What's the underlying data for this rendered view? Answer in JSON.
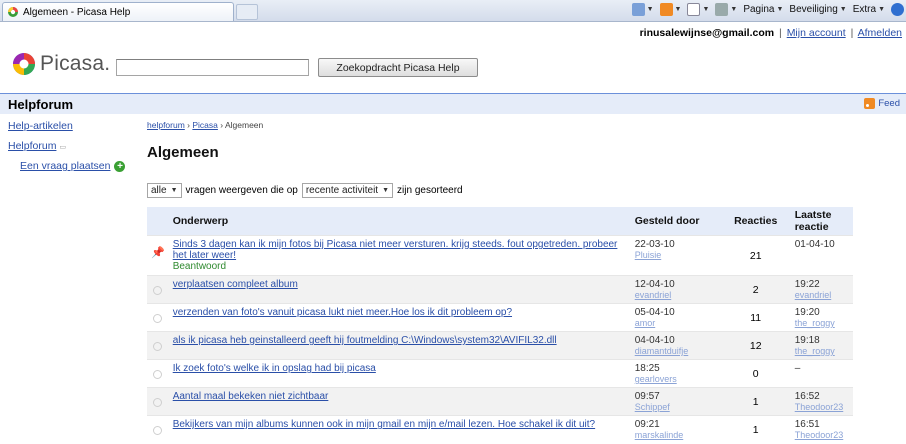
{
  "browser": {
    "tab_title": "Algemeen - Picasa Help",
    "toolbar": {
      "page_label": "Pagina",
      "security_label": "Beveiliging",
      "extras_label": "Extra"
    }
  },
  "account": {
    "email": "rinusalewijnse@gmail.com",
    "my_account": "Mijn account",
    "sign_out": "Afmelden"
  },
  "logo": {
    "text": "Picasa."
  },
  "search": {
    "value": "",
    "button_label": "Zoekopdracht Picasa Help"
  },
  "header": {
    "title": "Helpforum",
    "feed_label": "Feed"
  },
  "sidebar": {
    "help_articles": "Help-artikelen",
    "help_forum": "Helpforum",
    "ask_question": "Een vraag plaatsen"
  },
  "breadcrumb": {
    "root": "helpforum",
    "section": "Picasa",
    "current": "Algemeen"
  },
  "page_title": "Algemeen",
  "filter": {
    "scope": "alle",
    "text1": "vragen weergeven die op",
    "sort": "recente activiteit",
    "text2": "zijn gesorteerd"
  },
  "table": {
    "headers": {
      "subject": "Onderwerp",
      "asked_by": "Gesteld door",
      "replies": "Reacties",
      "last_reply": "Laatste reactie"
    },
    "rows": [
      {
        "subject": "Sinds 3 dagen kan ik mijn fotos bij Picasa niet meer versturen. krijg steeds. fout opgetreden. probeer het later weer!",
        "status": "Beantwoord",
        "date": "22-03-10",
        "author": "Pluisie",
        "replies": "21",
        "last_time": "01-04-10",
        "last_author": ""
      },
      {
        "subject": "verplaatsen compleet album",
        "status": "",
        "date": "12-04-10",
        "author": "evandriel",
        "replies": "2",
        "last_time": "19:22",
        "last_author": "evandriel"
      },
      {
        "subject": "verzenden van foto's vanuit picasa lukt niet meer.Hoe los ik dit probleem op?",
        "status": "",
        "date": "05-04-10",
        "author": "amor",
        "replies": "11",
        "last_time": "19:20",
        "last_author": "the_roggy"
      },
      {
        "subject": "als ik picasa heb geinstalleerd geeft hij foutmelding C:\\Windows\\system32\\AVIFIL32.dll",
        "status": "",
        "date": "04-04-10",
        "author": "diamantduifje",
        "replies": "12",
        "last_time": "19:18",
        "last_author": "the_roggy"
      },
      {
        "subject": "Ik zoek foto's welke ik in opslag had bij picasa",
        "status": "",
        "date": "18:25",
        "author": "gearlovers",
        "replies": "0",
        "last_time": "–",
        "last_author": ""
      },
      {
        "subject": "Aantal maal bekeken niet zichtbaar",
        "status": "",
        "date": "09:57",
        "author": "Schippef",
        "replies": "1",
        "last_time": "16:52",
        "last_author": "Theodoor23"
      },
      {
        "subject": "Bekijkers van mijn albums kunnen ook in mijn gmail en mijn e/mail lezen. Hoe schakel ik dit uit?",
        "status": "",
        "date": "09:21",
        "author": "marskalinde",
        "replies": "1",
        "last_time": "16:51",
        "last_author": "Theodoor23"
      }
    ]
  },
  "colors": {
    "header_bg": "#e5ecf9",
    "link": "#2a4fa8",
    "answered": "#2f8a2f"
  }
}
